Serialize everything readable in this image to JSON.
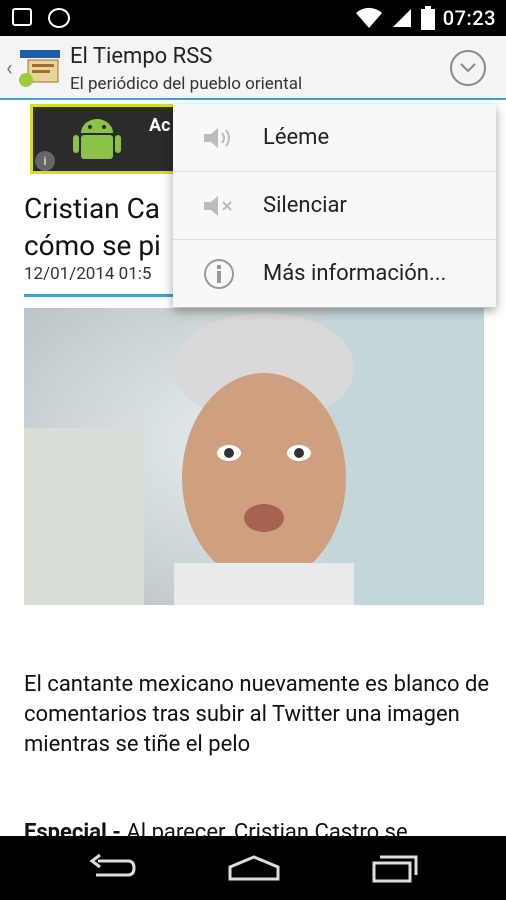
{
  "status_bar": {
    "time": "07:23"
  },
  "action_bar": {
    "title": "El Tiempo RSS",
    "subtitle": "El periódico del pueblo oriental"
  },
  "ad": {
    "text": "Ac",
    "info": "i"
  },
  "article": {
    "headline_visible": "Cristian Ca\ncómo se pi",
    "date": "12/01/2014 01:5",
    "lead": "El cantante mexicano nuevamente es blanco de comentarios tras subir al Twitter una imagen mientras se tiñe el pelo",
    "body_bold": "Especial -",
    "body_rest": " Al parecer, Cristian Castro se"
  },
  "menu": {
    "items": [
      {
        "label": "Léeme",
        "icon": "speaker-icon"
      },
      {
        "label": "Silenciar",
        "icon": "speaker-mute-icon"
      },
      {
        "label": "Más información...",
        "icon": "info-icon"
      }
    ]
  },
  "colors": {
    "accent": "#3aa2d8",
    "ad_border": "#d7dd1c"
  }
}
